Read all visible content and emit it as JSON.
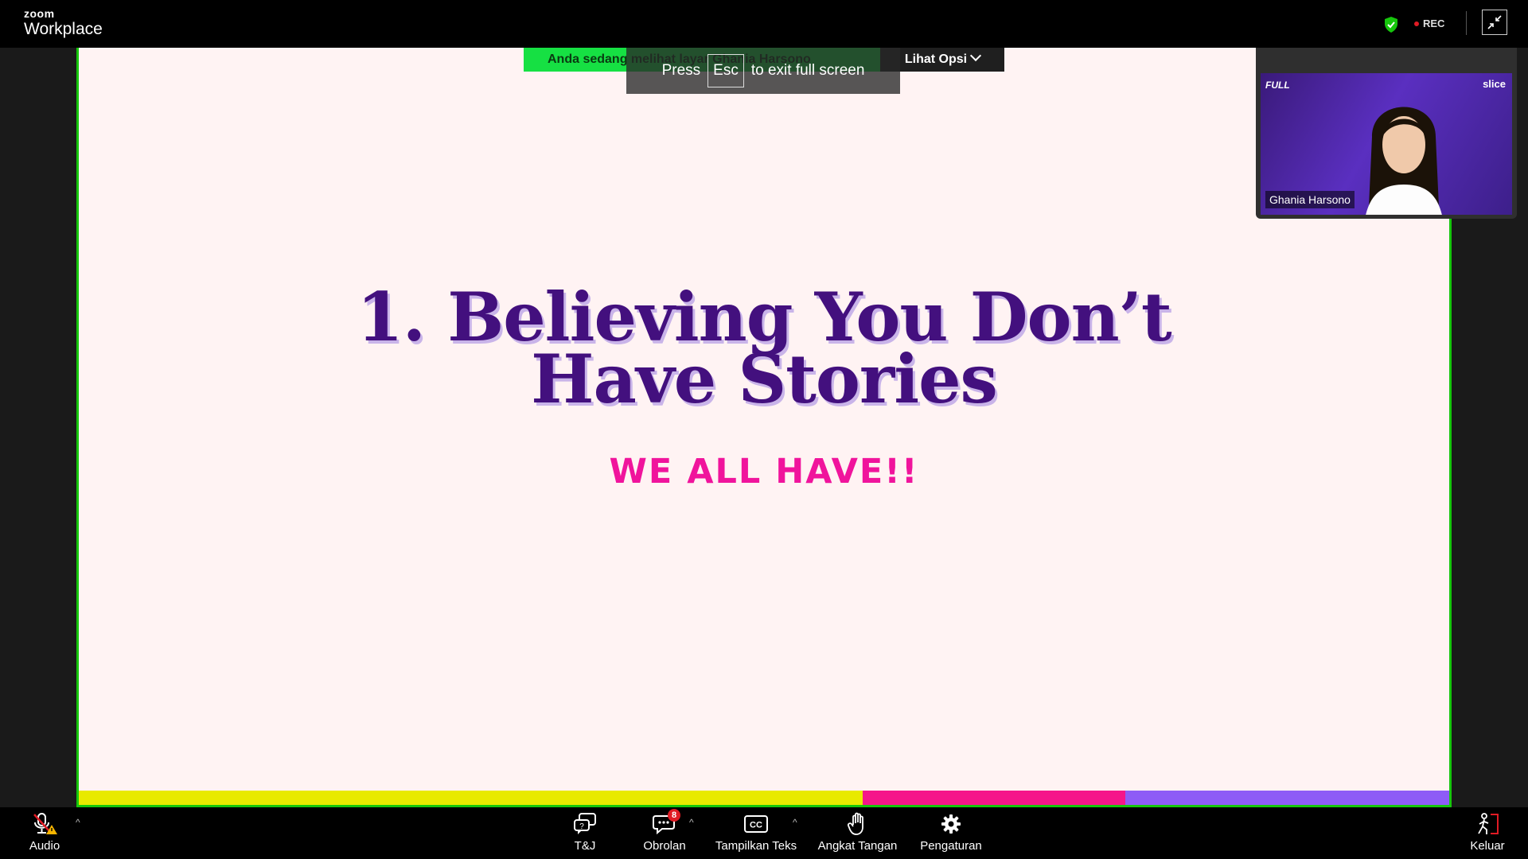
{
  "top_bar": {
    "logo_small": "zoom",
    "logo_big": "Workplace",
    "security_icon": "shield-check-icon",
    "rec_label": "REC",
    "exit_fullscreen_icon": "minimize-icon"
  },
  "share_banner": {
    "text": "Anda sedang melihat layar Ghania Harsono",
    "view_options_label": "Lihat Opsi"
  },
  "fullscreen_toast": {
    "before": "Press",
    "key": "Esc",
    "after": "to exit full screen"
  },
  "slide": {
    "title_line1": "1. Believing You Don’t",
    "title_line2": "Have Stories",
    "subtitle": "WE ALL HAVE!!",
    "colors": {
      "background": "#fff3f3",
      "title": "#43107e",
      "subtitle": "#f0149c",
      "bar_yellow": "#e8ea00",
      "bar_pink": "#f5168a",
      "bar_purple": "#8e5cf6"
    }
  },
  "video": {
    "brand_left": "FULL",
    "brand_right": "slice",
    "participant_name": "Ghania Harsono"
  },
  "toolbar": {
    "audio": {
      "label": "Audio",
      "icon": "mic-muted-warning-icon"
    },
    "qa": {
      "label": "T&J",
      "icon": "qa-icon"
    },
    "chat": {
      "label": "Obrolan",
      "icon": "chat-icon",
      "badge": "8"
    },
    "captions": {
      "label": "Tampilkan Teks",
      "icon": "cc-icon"
    },
    "raise_hand": {
      "label": "Angkat Tangan",
      "icon": "hand-icon"
    },
    "settings": {
      "label": "Pengaturan",
      "icon": "gear-icon"
    },
    "leave": {
      "label": "Keluar",
      "icon": "exit-icon"
    }
  }
}
